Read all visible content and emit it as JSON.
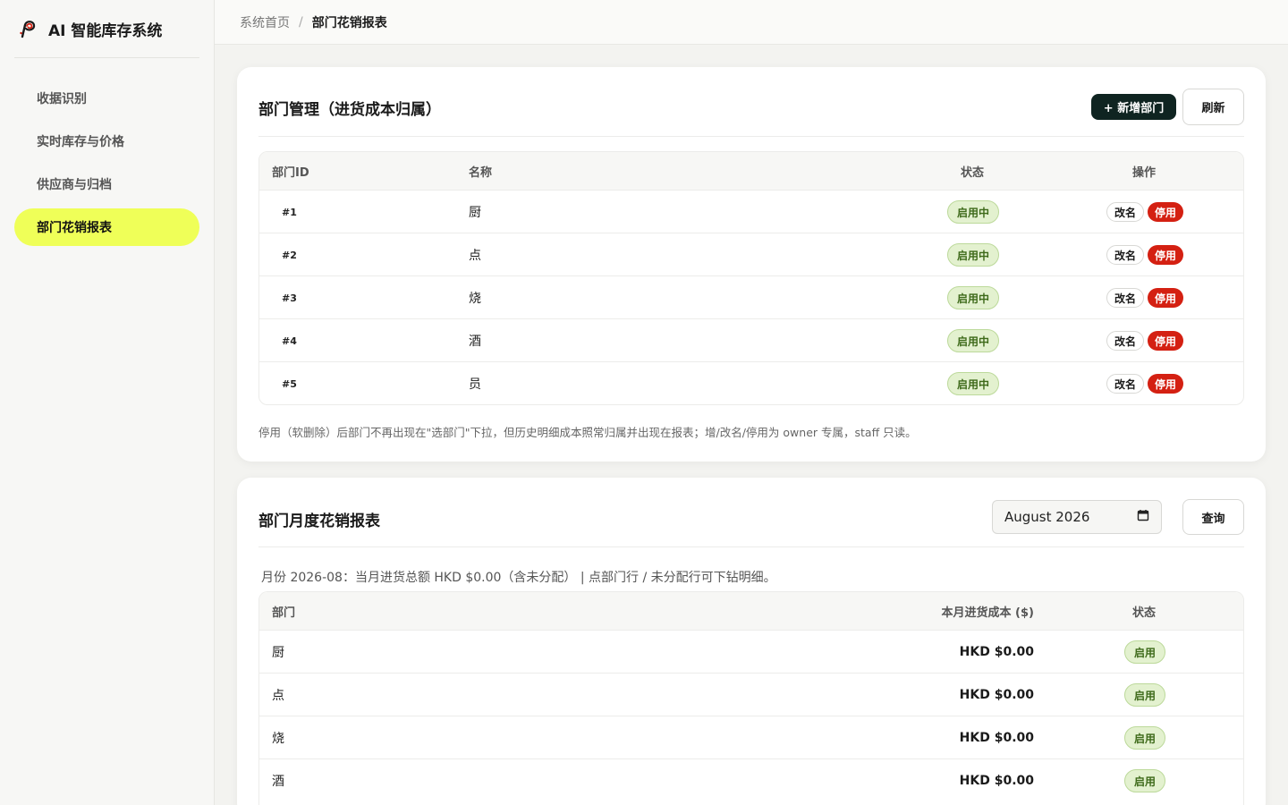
{
  "app": {
    "title": "AI 智能库存系统",
    "logo_icon": "swirl-logo-icon"
  },
  "sidebar": {
    "items": [
      {
        "label": "收据识别",
        "active": false
      },
      {
        "label": "实时库存与价格",
        "active": false
      },
      {
        "label": "供应商与归档",
        "active": false
      },
      {
        "label": "部门花销报表",
        "active": true
      }
    ]
  },
  "breadcrumb": {
    "home": "系统首页",
    "separator": "/",
    "current": "部门花销报表"
  },
  "dept_mgmt": {
    "title": "部门管理（进货成本归属）",
    "add_button": "+ 新增部门",
    "refresh_button": "刷新",
    "columns": {
      "id": "部门ID",
      "name": "名称",
      "status": "状态",
      "actions": "操作"
    },
    "rows": [
      {
        "id": "#1",
        "name": "厨",
        "status": "启用中",
        "rename": "改名",
        "disable": "停用"
      },
      {
        "id": "#2",
        "name": "点",
        "status": "启用中",
        "rename": "改名",
        "disable": "停用"
      },
      {
        "id": "#3",
        "name": "烧",
        "status": "启用中",
        "rename": "改名",
        "disable": "停用"
      },
      {
        "id": "#4",
        "name": "酒",
        "status": "启用中",
        "rename": "改名",
        "disable": "停用"
      },
      {
        "id": "#5",
        "name": "员",
        "status": "启用中",
        "rename": "改名",
        "disable": "停用"
      }
    ],
    "note": "停用（软删除）后部门不再出现在\"选部门\"下拉，但历史明细成本照常归属并出现在报表；增/改名/停用为 owner 专属，staff 只读。"
  },
  "monthly_report": {
    "title": "部门月度花销报表",
    "month_value": "August  2026",
    "query_button": "查询",
    "summary": "月份 2026-08：当月进货总额 HKD $0.00（含未分配） | 点部门行 / 未分配行可下钻明细。",
    "columns": {
      "dept": "部门",
      "cost": "本月进货成本 ($)",
      "status": "状态"
    },
    "rows": [
      {
        "dept": "厨",
        "cost": "HKD $0.00",
        "status": "启用"
      },
      {
        "dept": "点",
        "cost": "HKD $0.00",
        "status": "启用"
      },
      {
        "dept": "烧",
        "cost": "HKD $0.00",
        "status": "启用"
      },
      {
        "dept": "酒",
        "cost": "HKD $0.00",
        "status": "启用"
      }
    ]
  },
  "colors": {
    "accent": "#efff58",
    "dark_button": "#0f2421",
    "danger": "#d42012",
    "status_green_bg": "#e3f1cf"
  }
}
